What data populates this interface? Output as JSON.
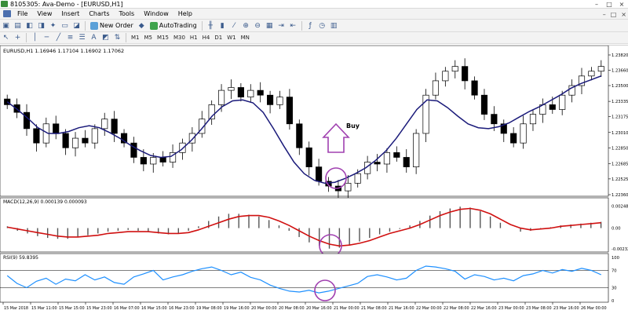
{
  "window": {
    "title": "8105305: Ava-Demo - [EURUSD,H1]",
    "controls": [
      "–",
      "□",
      "×"
    ]
  },
  "menu": {
    "items": [
      "File",
      "View",
      "Insert",
      "Charts",
      "Tools",
      "Window",
      "Help"
    ],
    "mdi_controls": [
      "–",
      "□",
      "×"
    ]
  },
  "toolbar": {
    "new_order_label": "New Order",
    "autotrading_label": "AutoTrading",
    "timeframes": [
      "M1",
      "M5",
      "M15",
      "M30",
      "H1",
      "H4",
      "D1",
      "W1",
      "MN"
    ]
  },
  "colors": {
    "up_candle": "#ffffff",
    "down_candle": "#000000",
    "ma_line": "#1a1a7a",
    "macd_signal": "#d01010",
    "macd_hist": "#555555",
    "rsi_line": "#1e90ff",
    "highlight": "#a040b0"
  },
  "chart_data": [
    {
      "type": "candlestick",
      "name": "EURUSD,H1",
      "header": "EURUSD,H1  1.16946 1.17104 1.16902 1.17062",
      "price_labels": [
        "1.23820",
        "1.23660",
        "1.23500",
        "1.23335",
        "1.23175",
        "1.23010",
        "1.22850",
        "1.22685",
        "1.22525",
        "1.22360"
      ],
      "ylim": [
        1.2236,
        1.2382
      ],
      "annotation": "Buy",
      "close": [
        1.233,
        1.2322,
        1.2305,
        1.229,
        1.231,
        1.23,
        1.2285,
        1.2295,
        1.229,
        1.2305,
        1.2315,
        1.23,
        1.229,
        1.2275,
        1.2268,
        1.2275,
        1.227,
        1.228,
        1.229,
        1.23,
        1.2315,
        1.233,
        1.2345,
        1.2348,
        1.2338,
        1.2345,
        1.234,
        1.233,
        1.2338,
        1.231,
        1.2285,
        1.2265,
        1.225,
        1.2245,
        1.224,
        1.2248,
        1.2258,
        1.227,
        1.2268,
        1.228,
        1.2275,
        1.2265,
        1.23,
        1.234,
        1.2355,
        1.2365,
        1.237,
        1.2355,
        1.234,
        1.232,
        1.231,
        1.23,
        1.229,
        1.231,
        1.232,
        1.233,
        1.2325,
        1.234,
        1.235,
        1.236,
        1.2365,
        1.237
      ],
      "ma": [
        1.2333,
        1.2325,
        1.2316,
        1.2306,
        1.23,
        1.23,
        1.2302,
        1.2306,
        1.2308,
        1.2306,
        1.2301,
        1.2295,
        1.2288,
        1.2282,
        1.2277,
        1.2275,
        1.2276,
        1.2283,
        1.2293,
        1.2305,
        1.2318,
        1.2328,
        1.2334,
        1.2335,
        1.2332,
        1.2322,
        1.2305,
        1.2287,
        1.227,
        1.2258,
        1.2251,
        1.2248,
        1.2249,
        1.2253,
        1.2258,
        1.2264,
        1.2272,
        1.2282,
        1.2295,
        1.231,
        1.2325,
        1.2335,
        1.2334,
        1.2327,
        1.2318,
        1.231,
        1.2306,
        1.2305,
        1.2307,
        1.2311,
        1.2317,
        1.2323,
        1.2328,
        1.2334,
        1.234,
        1.2347,
        1.2352,
        1.2356,
        1.236
      ]
    },
    {
      "type": "bar",
      "name": "MACD(12,26,9)",
      "header": "MACD(12,26,9) 0.000139 0.000093",
      "price_labels": [
        "0.002484",
        "0.00",
        "-0.002323"
      ],
      "ylim": [
        -0.0025,
        0.0026
      ],
      "histogram": [
        0.0002,
        -0.0003,
        -0.0006,
        -0.0009,
        -0.0011,
        -0.0012,
        -0.0012,
        -0.001,
        -0.0008,
        -0.0006,
        -0.0004,
        -0.0003,
        -0.0002,
        -0.0003,
        -0.0004,
        -0.0006,
        -0.0007,
        -0.0006,
        -0.0003,
        0.0002,
        0.0008,
        0.0013,
        0.0016,
        0.0016,
        0.0015,
        0.0013,
        0.0009,
        0.0003,
        -0.0003,
        -0.001,
        -0.0016,
        -0.002,
        -0.0023,
        -0.0022,
        -0.0019,
        -0.0015,
        -0.0011,
        -0.0007,
        -0.0004,
        -0.0001,
        0.0003,
        0.0008,
        0.0014,
        0.0019,
        0.0022,
        0.0024,
        0.0023,
        0.0019,
        0.0013,
        0.0006,
        0.0,
        -0.0004,
        -0.0003,
        -0.0001,
        0.0001,
        0.0003,
        0.0004,
        0.0005,
        0.0006,
        0.0007
      ],
      "signal": [
        0.0001,
        -0.0001,
        -0.0003,
        -0.0005,
        -0.0007,
        -0.0009,
        -0.001,
        -0.001,
        -0.0009,
        -0.0008,
        -0.0006,
        -0.0005,
        -0.0004,
        -0.0004,
        -0.0004,
        -0.0005,
        -0.0006,
        -0.0006,
        -0.0005,
        -0.0002,
        0.0002,
        0.0006,
        0.001,
        0.0013,
        0.0014,
        0.0014,
        0.0012,
        0.0008,
        0.0003,
        -0.0003,
        -0.0009,
        -0.0014,
        -0.0018,
        -0.002,
        -0.0019,
        -0.0017,
        -0.0014,
        -0.001,
        -0.0006,
        -0.0003,
        0.0,
        0.0004,
        0.0009,
        0.0014,
        0.0018,
        0.0021,
        0.0022,
        0.002,
        0.0016,
        0.001,
        0.0004,
        0.0,
        -0.0002,
        -0.0001,
        0.0,
        0.0002,
        0.0003,
        0.0004,
        0.0005,
        0.0006
      ]
    },
    {
      "type": "line",
      "name": "RSI(9)",
      "header": "RSI(9) 59.8395",
      "price_labels": [
        "100",
        "70",
        "30",
        "0"
      ],
      "ylim": [
        0,
        100
      ],
      "levels": [
        70,
        30
      ],
      "values": [
        58,
        40,
        30,
        45,
        52,
        38,
        50,
        46,
        60,
        48,
        55,
        42,
        38,
        55,
        62,
        70,
        48,
        55,
        60,
        68,
        74,
        78,
        70,
        60,
        66,
        54,
        48,
        36,
        28,
        22,
        20,
        24,
        18,
        22,
        28,
        34,
        40,
        56,
        60,
        55,
        48,
        52,
        70,
        80,
        78,
        74,
        68,
        50,
        60,
        56,
        48,
        52,
        46,
        58,
        62,
        70,
        64,
        72,
        68,
        75,
        70,
        60
      ]
    }
  ],
  "time_axis": [
    "15 Mar 2018",
    "15 Mar 11:00",
    "15 Mar 15:00",
    "15 Mar 23:00",
    "16 Mar 07:00",
    "16 Mar 15:00",
    "16 Mar 23:00",
    "19 Mar 08:00",
    "19 Mar 16:00",
    "20 Mar 00:00",
    "20 Mar 08:00",
    "20 Mar 16:00",
    "21 Mar 00:00",
    "21 Mar 08:00",
    "21 Mar 16:00",
    "22 Mar 00:00",
    "22 Mar 08:00",
    "22 Mar 16:00",
    "23 Mar 00:00",
    "23 Mar 08:00",
    "23 Mar 16:00",
    "26 Mar 00:00"
  ]
}
